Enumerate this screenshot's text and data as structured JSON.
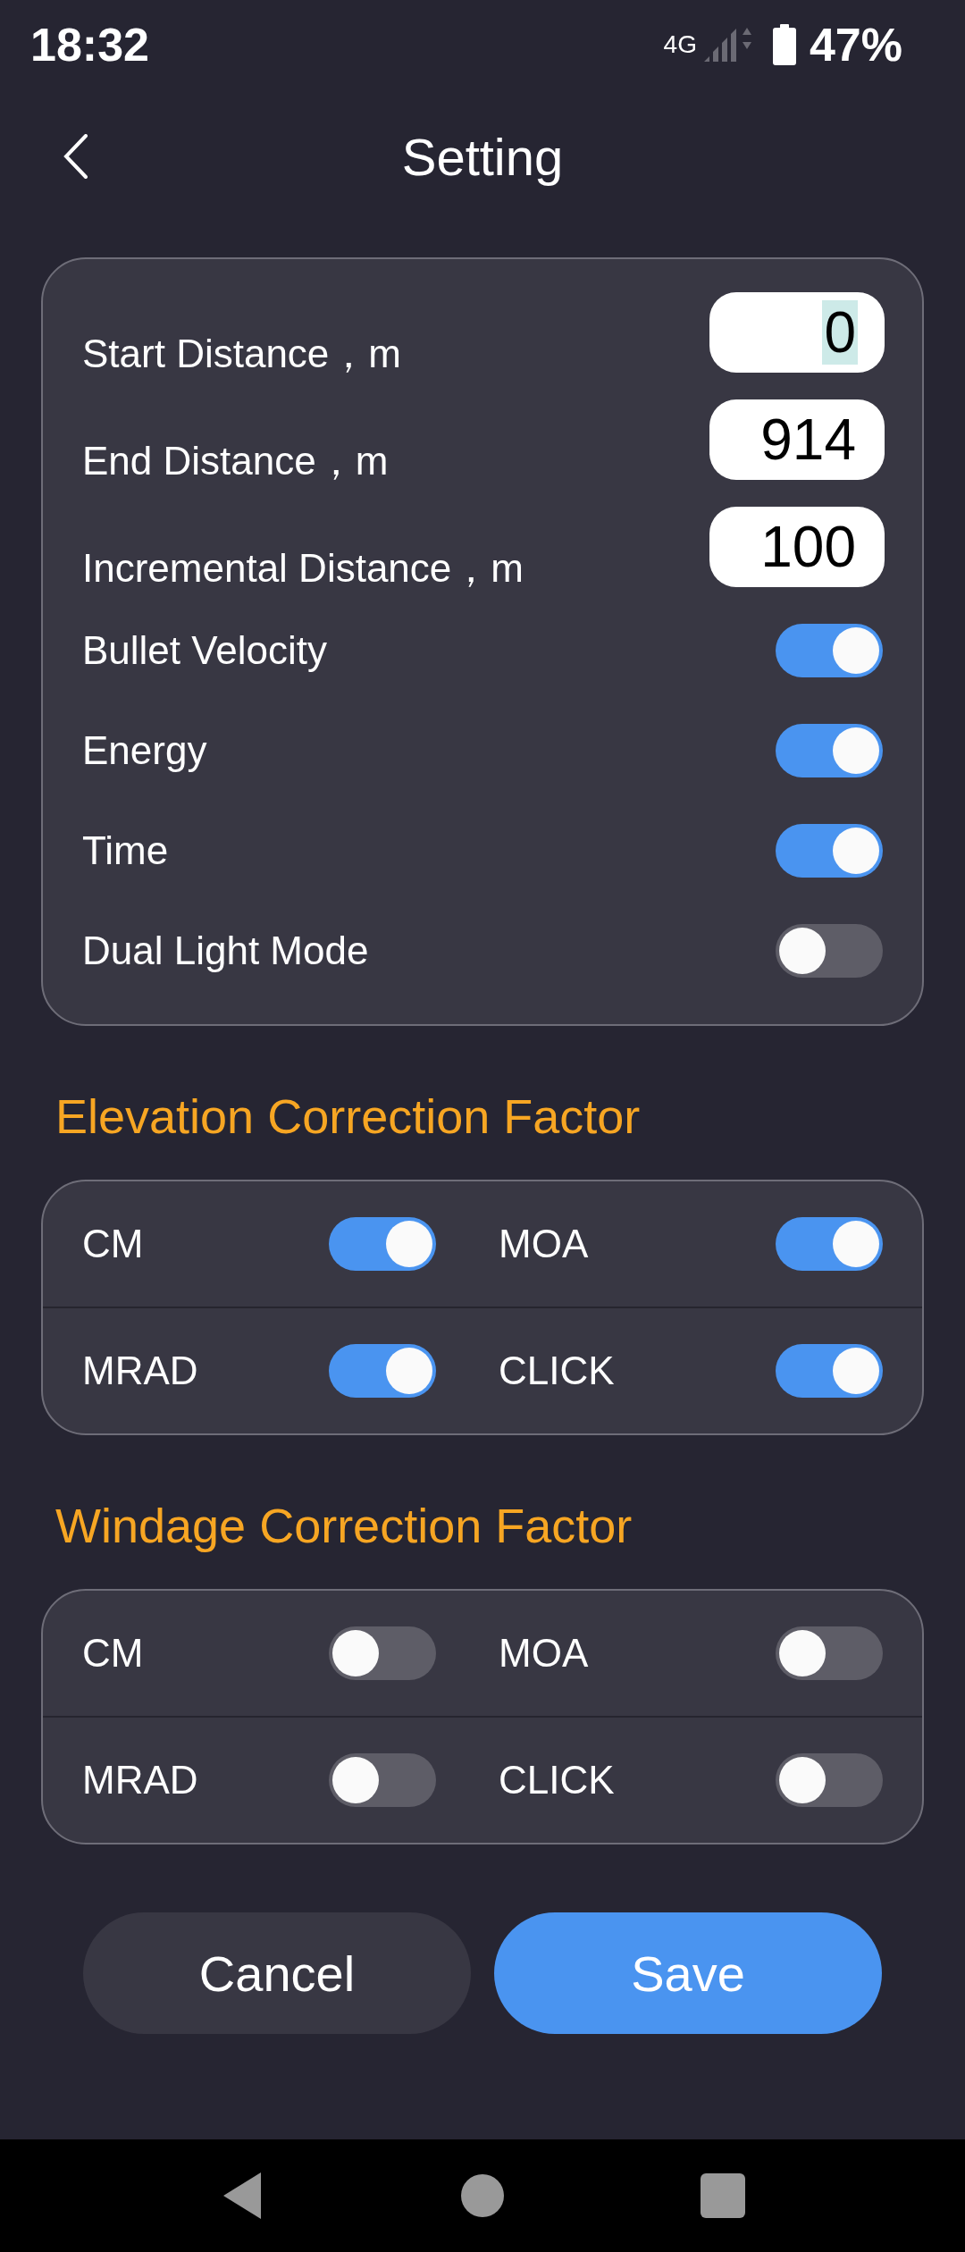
{
  "status_bar": {
    "time": "18:32",
    "network": "4G",
    "battery": "47%"
  },
  "header": {
    "title": "Setting"
  },
  "settings": [
    {
      "kind": "input",
      "label": "Start Distance，m",
      "value": "0",
      "text_selected": true
    },
    {
      "kind": "input",
      "label": "End Distance，m",
      "value": "914",
      "text_selected": false
    },
    {
      "kind": "input",
      "label": "Incremental Distance，m",
      "value": "100",
      "text_selected": false
    },
    {
      "kind": "toggle",
      "label": "Bullet Velocity",
      "on": true
    },
    {
      "kind": "toggle",
      "label": "Energy",
      "on": true
    },
    {
      "kind": "toggle",
      "label": "Time",
      "on": true
    },
    {
      "kind": "toggle",
      "label": "Dual Light Mode",
      "on": false
    }
  ],
  "groups": [
    {
      "title": "Elevation Correction Factor",
      "rows": [
        [
          {
            "label": "CM",
            "on": true
          },
          {
            "label": "MOA",
            "on": true
          }
        ],
        [
          {
            "label": "MRAD",
            "on": true
          },
          {
            "label": "CLICK",
            "on": true
          }
        ]
      ]
    },
    {
      "title": "Windage Correction Factor",
      "rows": [
        [
          {
            "label": "CM",
            "on": false
          },
          {
            "label": "MOA",
            "on": false
          }
        ],
        [
          {
            "label": "MRAD",
            "on": false
          },
          {
            "label": "CLICK",
            "on": false
          }
        ]
      ]
    }
  ],
  "buttons": [
    {
      "label": "Cancel",
      "kind": "secondary"
    },
    {
      "label": "Save",
      "kind": "primary"
    }
  ]
}
